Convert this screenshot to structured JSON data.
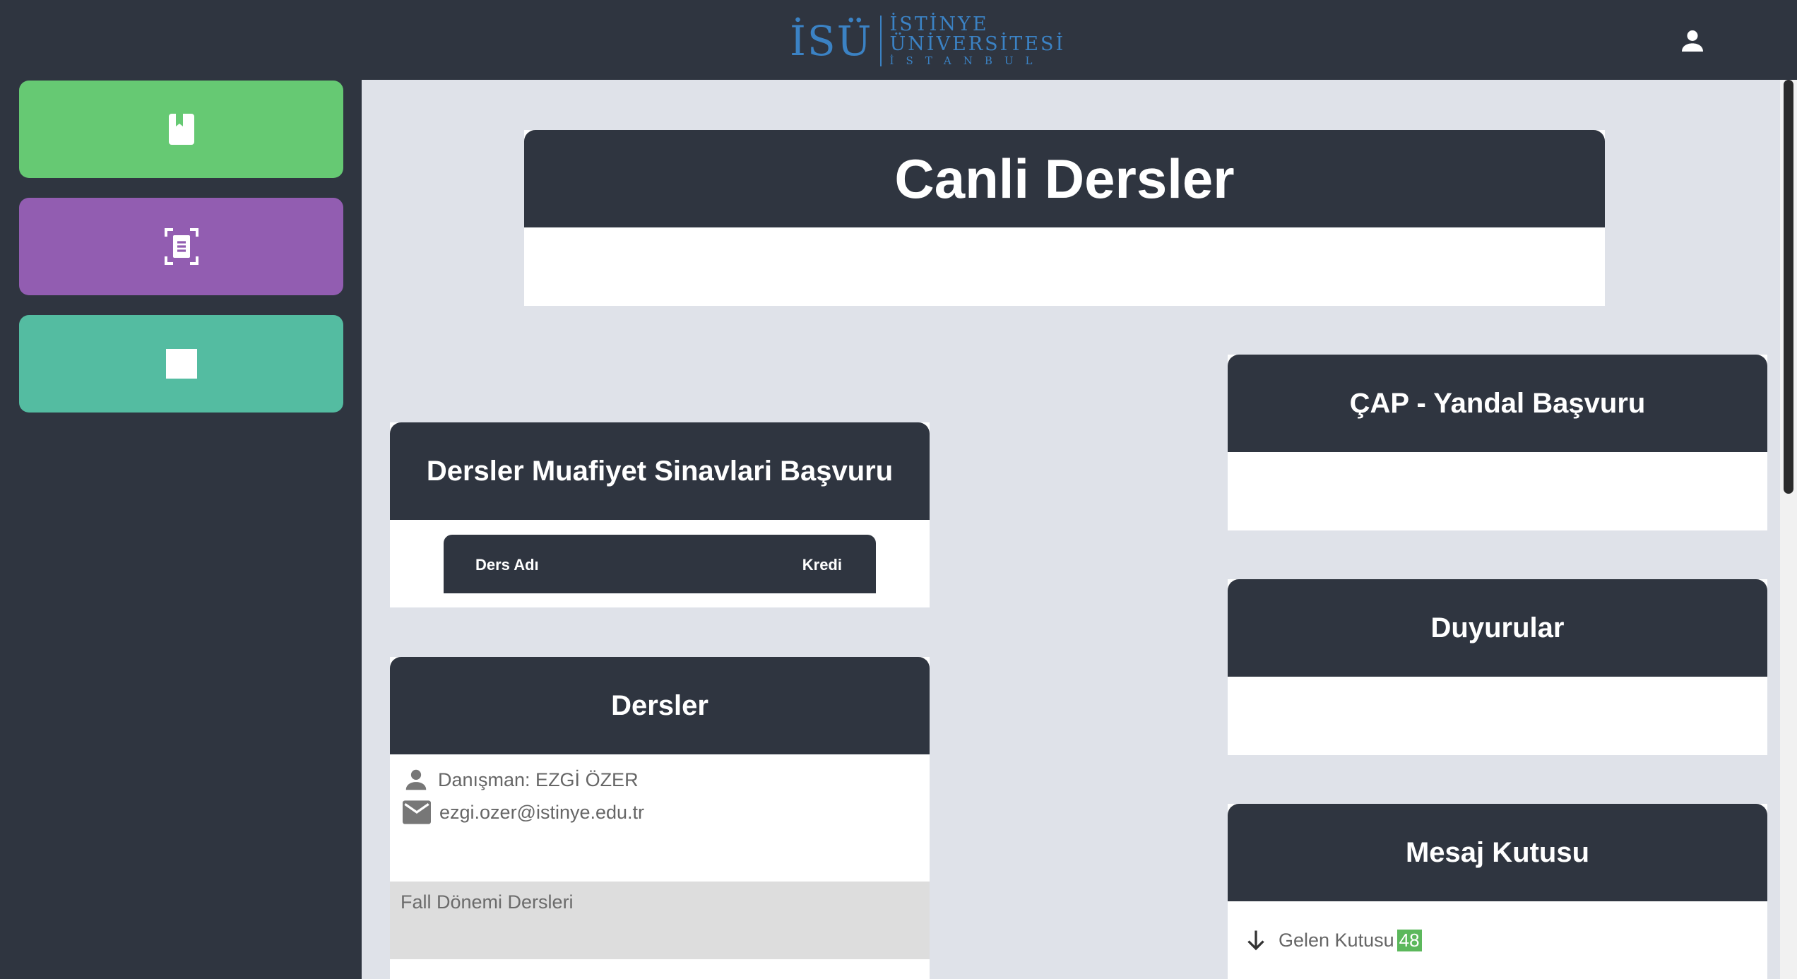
{
  "header": {
    "logo_mark": "İSÜ",
    "logo_line1": "İSTİNYE",
    "logo_line2": "ÜNİVERSİTESİ",
    "logo_line3": "İSTANBUL",
    "logo_color": "#3b82c4",
    "user_icon": "user-icon"
  },
  "sidebar": {
    "buttons": [
      {
        "icon": "book-icon",
        "color": "#66c973"
      },
      {
        "icon": "document-scan-icon",
        "color": "#925db1"
      },
      {
        "icon": "square-icon",
        "color": "#54bca1"
      }
    ]
  },
  "main": {
    "canli_dersler": {
      "title": "Canli Dersler"
    },
    "muafiyet": {
      "title": "Dersler Muafiyet Sinavlari Başvuru",
      "columns": [
        "Ders Adı",
        "Kredi"
      ]
    },
    "dersler": {
      "title": "Dersler",
      "advisor": "Danışman: EZGİ ÖZER",
      "email": "ezgi.ozer@istinye.edu.tr",
      "semester": "Fall Dönemi Dersleri"
    },
    "cap": {
      "title": "ÇAP - Yandal Başvuru"
    },
    "duyurular": {
      "title": "Duyurular"
    },
    "mesaj": {
      "title": "Mesaj Kutusu",
      "inbox_label": "Gelen Kutusu",
      "inbox_count": "48"
    }
  }
}
